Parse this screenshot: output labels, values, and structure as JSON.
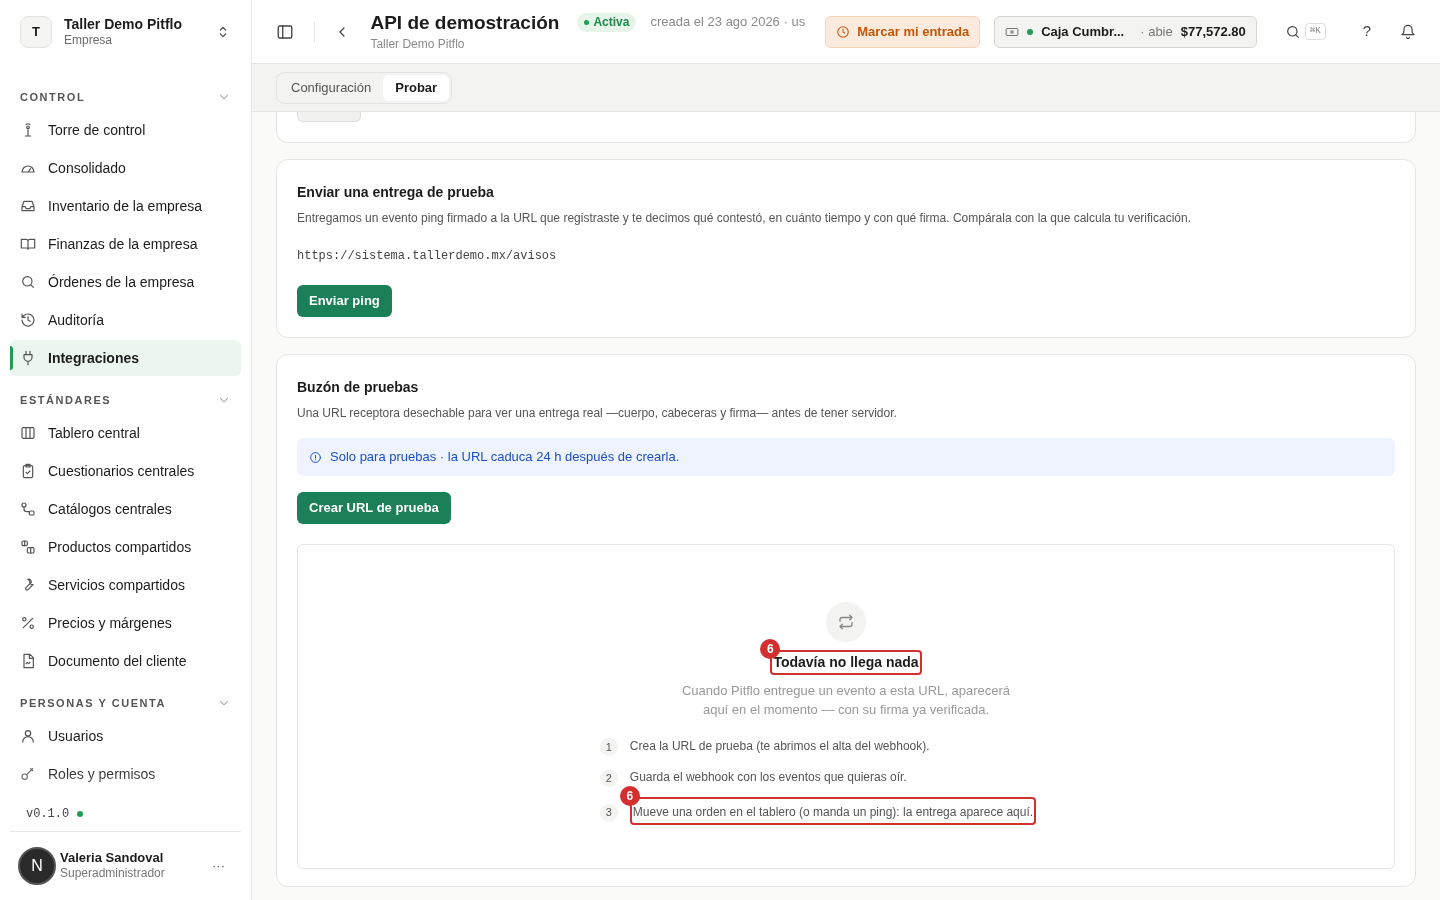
{
  "org": {
    "initial": "T",
    "name": "Taller Demo Pitflo",
    "subtitle": "Empresa"
  },
  "sidebar": {
    "groups": [
      {
        "title": "CONTROL",
        "expanded": true,
        "items": [
          {
            "label": "Torre de control",
            "selected": false
          },
          {
            "label": "Consolidado",
            "selected": false
          },
          {
            "label": "Inventario de la empresa",
            "selected": false
          },
          {
            "label": "Finanzas de la empresa",
            "selected": false
          },
          {
            "label": "Órdenes de la empresa",
            "selected": false
          },
          {
            "label": "Auditoría",
            "selected": false
          },
          {
            "label": "Integraciones",
            "selected": true
          }
        ]
      },
      {
        "title": "ESTÁNDARES",
        "expanded": true,
        "items": [
          {
            "label": "Tablero central",
            "selected": false
          },
          {
            "label": "Cuestionarios centrales",
            "selected": false
          },
          {
            "label": "Catálogos centrales",
            "selected": false
          },
          {
            "label": "Productos compartidos",
            "selected": false
          },
          {
            "label": "Servicios compartidos",
            "selected": false
          },
          {
            "label": "Precios y márgenes",
            "selected": false
          },
          {
            "label": "Documento del cliente",
            "selected": false
          }
        ]
      },
      {
        "title": "PERSONAS Y CUENTA",
        "expanded": true,
        "items": [
          {
            "label": "Usuarios",
            "selected": false
          },
          {
            "label": "Roles y permisos",
            "selected": false
          }
        ]
      }
    ],
    "version": "v0.1.0",
    "user": {
      "initial": "N",
      "name": "Valeria Sandoval",
      "role": "Superadministrador",
      "menu": "···"
    }
  },
  "header": {
    "title": "API de demostración",
    "subtitle": "Taller Demo Pitflo",
    "status": "Activa",
    "meta": "creada el 23 ago 2026 · us",
    "clock_in": "Marcar mi entrada",
    "register": {
      "name": "Caja Cumbr...",
      "state": "· abie",
      "amount": "$77,572.80"
    },
    "shortcut": "⌘K",
    "help": "?"
  },
  "tabs": [
    {
      "label": "Configuración",
      "selected": false
    },
    {
      "label": "Probar",
      "selected": true
    }
  ],
  "ping_card": {
    "title": "Enviar una entrega de prueba",
    "description": "Entregamos un evento ping firmado a la URL que registraste y te decimos qué contestó, en cuánto tiempo y con qué firma. Compárala con la que calcula tu verificación.",
    "url": "https://sistema.tallerdemo.mx/avisos",
    "button": "Enviar ping"
  },
  "inbox_card": {
    "title": "Buzón de pruebas",
    "description": "Una URL receptora desechable para ver una entrega real —cuerpo, cabeceras y firma— antes de tener servidor.",
    "notice": "Solo para pruebas · la URL caduca 24 h después de crearla.",
    "button": "Crear URL de prueba",
    "empty": {
      "title": "Todavía no llega nada",
      "title_marker": "6",
      "description": "Cuando Pitflo entregue un evento a esta URL, aparecerá aquí en el momento — con su firma ya verificada.",
      "steps": [
        {
          "number": "1",
          "text": "Crea la URL de prueba (te abrimos el alta del webhook)."
        },
        {
          "number": "2",
          "text": "Guarda el webhook con los eventos que quieras oír."
        },
        {
          "number": "3",
          "text": "Mueve una orden en el tablero (o manda un ping): la entrega aparece aquí.",
          "marker": "6"
        }
      ]
    }
  }
}
